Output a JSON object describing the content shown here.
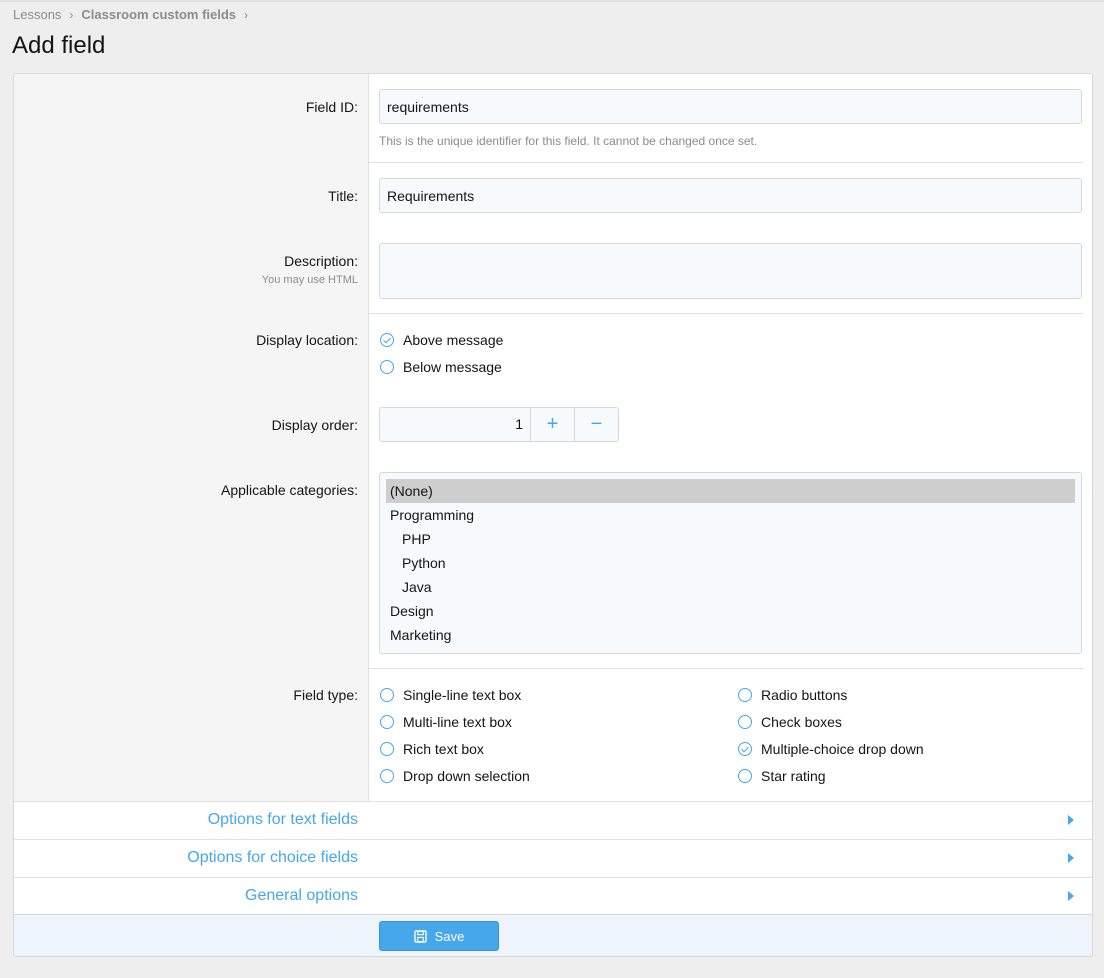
{
  "breadcrumb": {
    "items": [
      "Lessons",
      "Classroom custom fields"
    ]
  },
  "page": {
    "title": "Add field"
  },
  "form": {
    "field_id": {
      "label": "Field ID:",
      "value": "requirements",
      "hint": "This is the unique identifier for this field. It cannot be changed once set."
    },
    "title": {
      "label": "Title:",
      "value": "Requirements"
    },
    "description": {
      "label": "Description:",
      "hint": "You may use HTML",
      "value": ""
    },
    "display_location": {
      "label": "Display location:",
      "options": [
        {
          "label": "Above message",
          "checked": true
        },
        {
          "label": "Below message",
          "checked": false
        }
      ]
    },
    "display_order": {
      "label": "Display order:",
      "value": "1",
      "plus": "+",
      "minus": "−"
    },
    "categories": {
      "label": "Applicable categories:",
      "options": [
        "(None)",
        "Programming",
        "PHP",
        "Python",
        "Java",
        "Design",
        "Marketing"
      ],
      "selected": "(None)"
    },
    "field_type": {
      "label": "Field type:",
      "options": [
        {
          "label": "Single-line text box",
          "checked": false
        },
        {
          "label": "Multi-line text box",
          "checked": false
        },
        {
          "label": "Rich text box",
          "checked": false
        },
        {
          "label": "Drop down selection",
          "checked": false
        },
        {
          "label": "Radio buttons",
          "checked": false
        },
        {
          "label": "Check boxes",
          "checked": false
        },
        {
          "label": "Multiple-choice drop down",
          "checked": true
        },
        {
          "label": "Star rating",
          "checked": false
        }
      ]
    }
  },
  "sections": [
    {
      "label": "Options for text fields"
    },
    {
      "label": "Options for choice fields"
    },
    {
      "label": "General options"
    }
  ],
  "actions": {
    "save_label": "Save"
  },
  "colors": {
    "accent": "#47a7eb",
    "selected_option": "#cecece",
    "footer": "#edf4fb"
  }
}
